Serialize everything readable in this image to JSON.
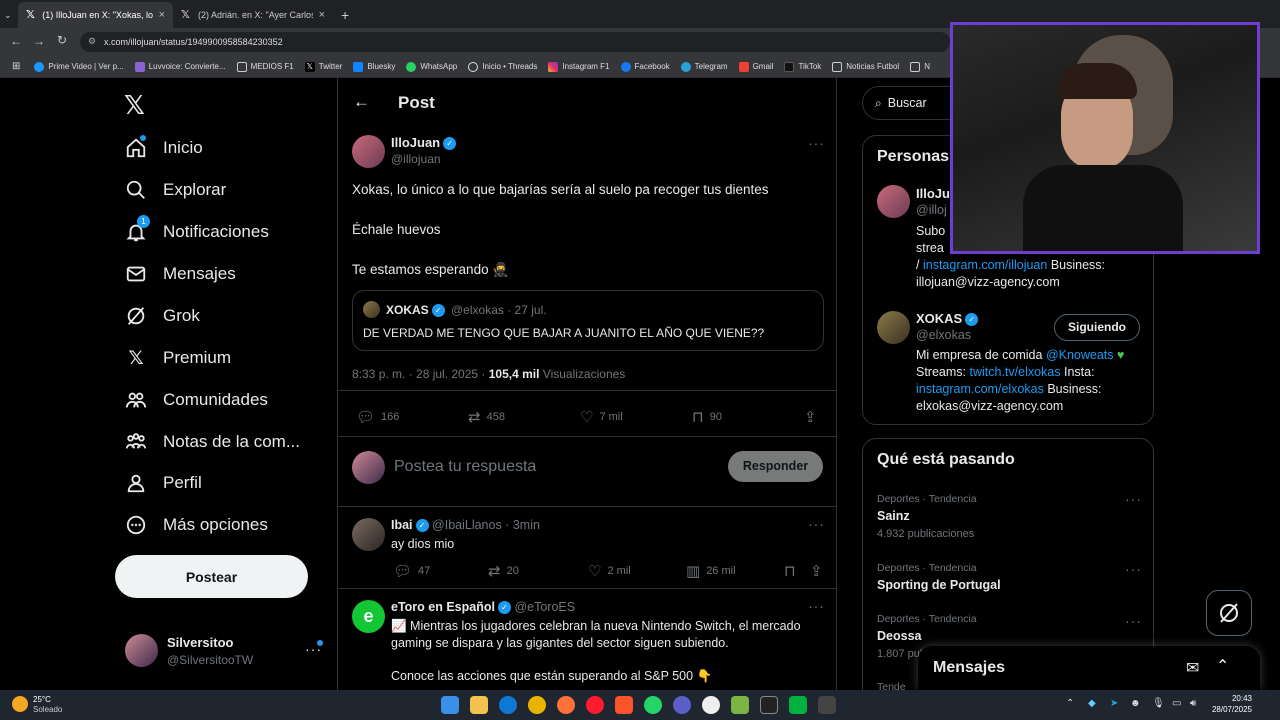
{
  "browser": {
    "tabs": [
      {
        "label": "(1) IlloJuan en X: \"Xokas, lo únic",
        "active": true
      },
      {
        "label": "(2) Adrián. en X: \"Ayer Carlos p",
        "active": false
      }
    ],
    "url": "x.com/illojuan/status/1949900958584230352",
    "bookmarks": [
      "Prime Video | Ver p...",
      "Luvvoice: Convierte...",
      "MEDIOS F1",
      "Twitter",
      "Bluesky",
      "WhatsApp",
      "Inicio • Threads",
      "Instagram F1",
      "Facebook",
      "Telegram",
      "Gmail",
      "TikTok",
      "Noticias Futbol",
      "N"
    ]
  },
  "nav": {
    "items": [
      "Inicio",
      "Explorar",
      "Notificaciones",
      "Mensajes",
      "Grok",
      "Premium",
      "Comunidades",
      "Notas de la com...",
      "Perfil",
      "Más opciones"
    ],
    "notif_badge": "1",
    "post_label": "Postear",
    "user": {
      "name": "Silversitoo",
      "handle": "@SilversitooTW"
    }
  },
  "post": {
    "header": "Post",
    "author": {
      "name": "IlloJuan",
      "handle": "@illojuan"
    },
    "lines": [
      "Xokas, lo único a lo que bajarías sería al suelo pa recoger tus dientes",
      "Échale huevos",
      "Te estamos esperando 🥷"
    ],
    "quote": {
      "name": "XOKAS",
      "handle": "@elxokas",
      "date": "· 27 jul.",
      "text": "DE VERDAD ME TENGO QUE BAJAR A JUANITO EL AÑO QUE VIENE??"
    },
    "meta": {
      "time": "8:33 p. m. · 28 jul. 2025 ·",
      "views": "105,4 mil",
      "views_label": "Visualizaciones"
    },
    "stats": {
      "replies": "166",
      "reposts": "458",
      "likes": "7 mil",
      "bookmarks": "90"
    },
    "reply_placeholder": "Postea tu respuesta",
    "reply_button": "Responder"
  },
  "replies": [
    {
      "name": "Ibai",
      "handle": "@IbaiLlanos",
      "time": "· 3min",
      "text": "ay dios mio",
      "replies": "47",
      "reposts": "20",
      "likes": "2 mil",
      "views": "26 mil"
    },
    {
      "name": "eToro en Español",
      "handle": "@eToroES",
      "text1": "📈 Mientras los jugadores celebran la nueva Nintendo Switch, el mercado gaming se dispara y las gigantes del sector siguen subiendo.",
      "text2": "Conoce las acciones que están superando al S&P 500 👇"
    }
  ],
  "right": {
    "search_placeholder": "Buscar",
    "people_title": "Personas",
    "person1": {
      "name": "IlloJu",
      "handle": "@illoj",
      "bio1": "Subo",
      "bio2": "strea",
      "bio3_prefix": "/",
      "link": "instagram.com/illojuan",
      "bio3_suffix": "Business:",
      "bio4": "illojuan@vizz-agency.com"
    },
    "person2": {
      "name": "XOKAS",
      "handle": "@elxokas",
      "follow": "Siguiendo",
      "bio1": "Mi empresa de comida",
      "mention": "@Knoweats",
      "bio2": "Streams:",
      "link1": "twitch.tv/elxokas",
      "bio2b": "Insta:",
      "link2": "instagram.com/elxokas",
      "bio3": "Business:",
      "bio4": "elxokas@vizz-agency.com"
    },
    "trends_title": "Qué está pasando",
    "trends": [
      {
        "cat": "Deportes · Tendencia",
        "name": "Sainz",
        "count": "4.932 publicaciones"
      },
      {
        "cat": "Deportes · Tendencia",
        "name": "Sporting de Portugal",
        "count": ""
      },
      {
        "cat": "Deportes · Tendencia",
        "name": "Deossa",
        "count": "1.807 pub"
      },
      {
        "cat": "Tende",
        "name": "",
        "count": ""
      }
    ],
    "messages": "Mensajes"
  },
  "taskbar": {
    "weather_temp": "25°C",
    "weather_label": "Soleado",
    "time": "20:43",
    "date": "28/07/2025"
  },
  "colors": {
    "accent": "#1d9bf0",
    "webcam_border": "#6e3ed4"
  }
}
